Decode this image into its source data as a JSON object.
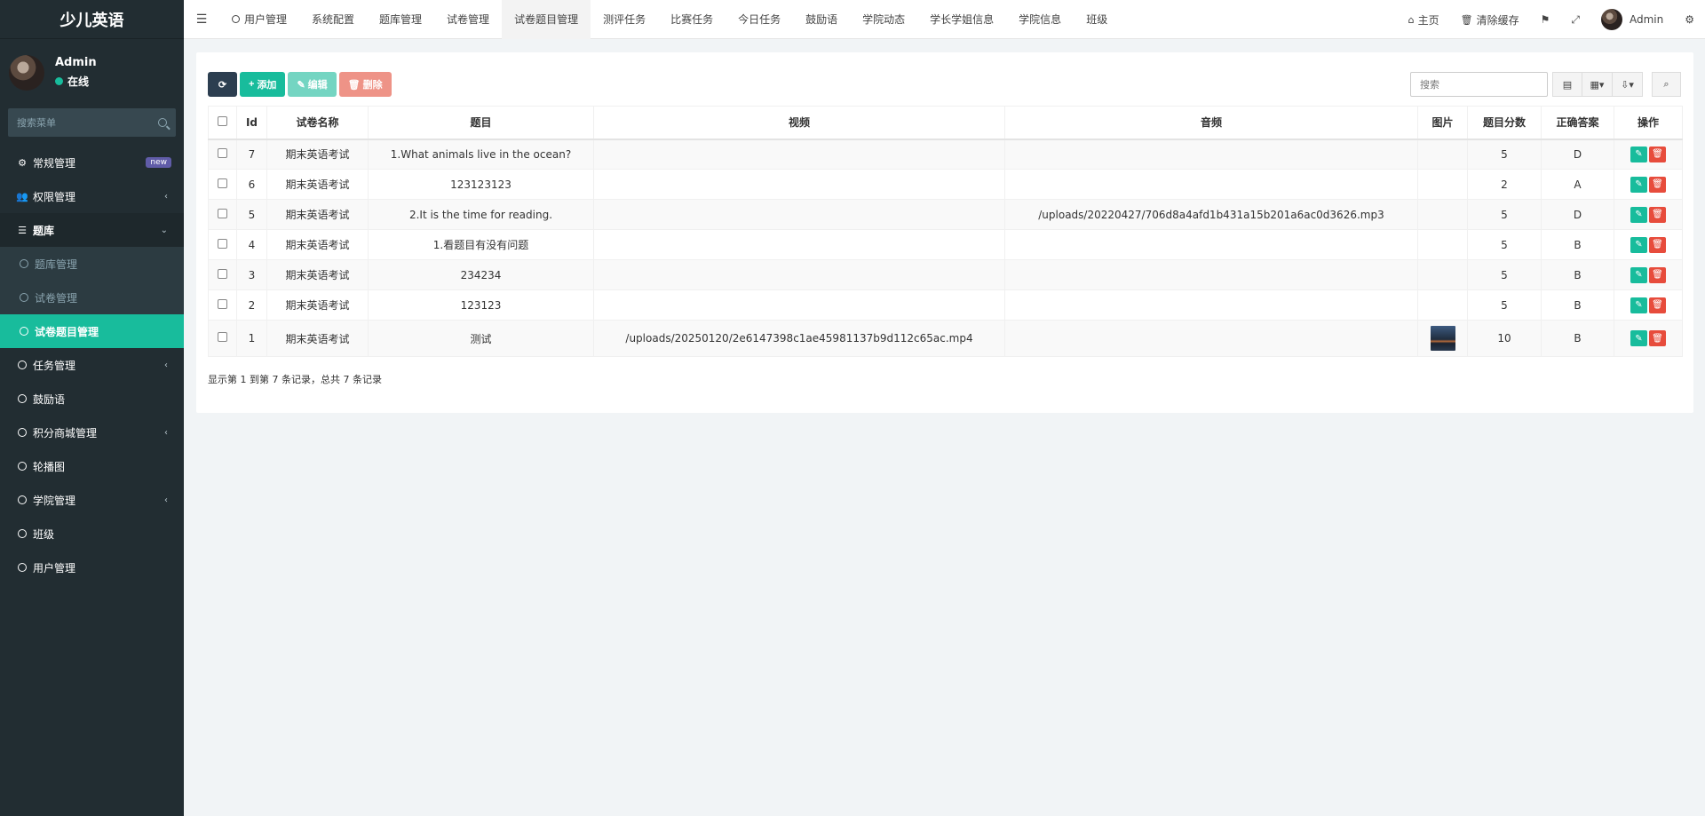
{
  "app": {
    "title": "少儿英语"
  },
  "user": {
    "name": "Admin",
    "status": "在线"
  },
  "sidebar": {
    "search_placeholder": "搜索菜单",
    "items": [
      {
        "label": "常规管理",
        "badge": "new"
      },
      {
        "label": "权限管理"
      },
      {
        "label": "题库"
      },
      {
        "label": "题库管理"
      },
      {
        "label": "试卷管理"
      },
      {
        "label": "试卷题目管理"
      },
      {
        "label": "任务管理"
      },
      {
        "label": "鼓励语"
      },
      {
        "label": "积分商城管理"
      },
      {
        "label": "轮播图"
      },
      {
        "label": "学院管理"
      },
      {
        "label": "班级"
      },
      {
        "label": "用户管理"
      }
    ]
  },
  "topnav": {
    "tabs": [
      "用户管理",
      "系统配置",
      "题库管理",
      "试卷管理",
      "试卷题目管理",
      "测评任务",
      "比赛任务",
      "今日任务",
      "鼓励语",
      "学院动态",
      "学长学姐信息",
      "学院信息",
      "班级"
    ],
    "home": "主页",
    "clear_cache": "清除缓存",
    "user": "Admin"
  },
  "toolbar": {
    "add": "添加",
    "edit": "编辑",
    "delete": "删除",
    "search_placeholder": "搜索"
  },
  "table": {
    "headers": [
      "Id",
      "试卷名称",
      "题目",
      "视频",
      "音频",
      "图片",
      "题目分数",
      "正确答案",
      "操作"
    ],
    "rows": [
      {
        "id": "7",
        "paper": "期末英语考试",
        "question": "1.What animals live in the ocean?",
        "video": "",
        "audio": "",
        "score": "5",
        "answer": "D"
      },
      {
        "id": "6",
        "paper": "期末英语考试",
        "question": "123123123",
        "video": "",
        "audio": "",
        "score": "2",
        "answer": "A"
      },
      {
        "id": "5",
        "paper": "期末英语考试",
        "question": "2.It is the time for reading.",
        "video": "",
        "audio": "/uploads/20220427/706d8a4afd1b431a15b201a6ac0d3626.mp3",
        "score": "5",
        "answer": "D"
      },
      {
        "id": "4",
        "paper": "期末英语考试",
        "question": "1.看题目有没有问题",
        "video": "",
        "audio": "",
        "score": "5",
        "answer": "B"
      },
      {
        "id": "3",
        "paper": "期末英语考试",
        "question": "234234",
        "video": "",
        "audio": "",
        "score": "5",
        "answer": "B"
      },
      {
        "id": "2",
        "paper": "期末英语考试",
        "question": "123123",
        "video": "",
        "audio": "",
        "score": "5",
        "answer": "B"
      },
      {
        "id": "1",
        "paper": "期末英语考试",
        "question": "测试",
        "video": "/uploads/20250120/2e6147398c1ae45981137b9d112c65ac.mp4",
        "audio": "",
        "score": "10",
        "answer": "B"
      }
    ],
    "footer": "显示第 1 到第 7 条记录，总共 7 条记录"
  },
  "colors": {
    "sidebar": "#222d32",
    "accent": "#18bc9c",
    "danger": "#e74c3c",
    "dark": "#2c3e50"
  }
}
